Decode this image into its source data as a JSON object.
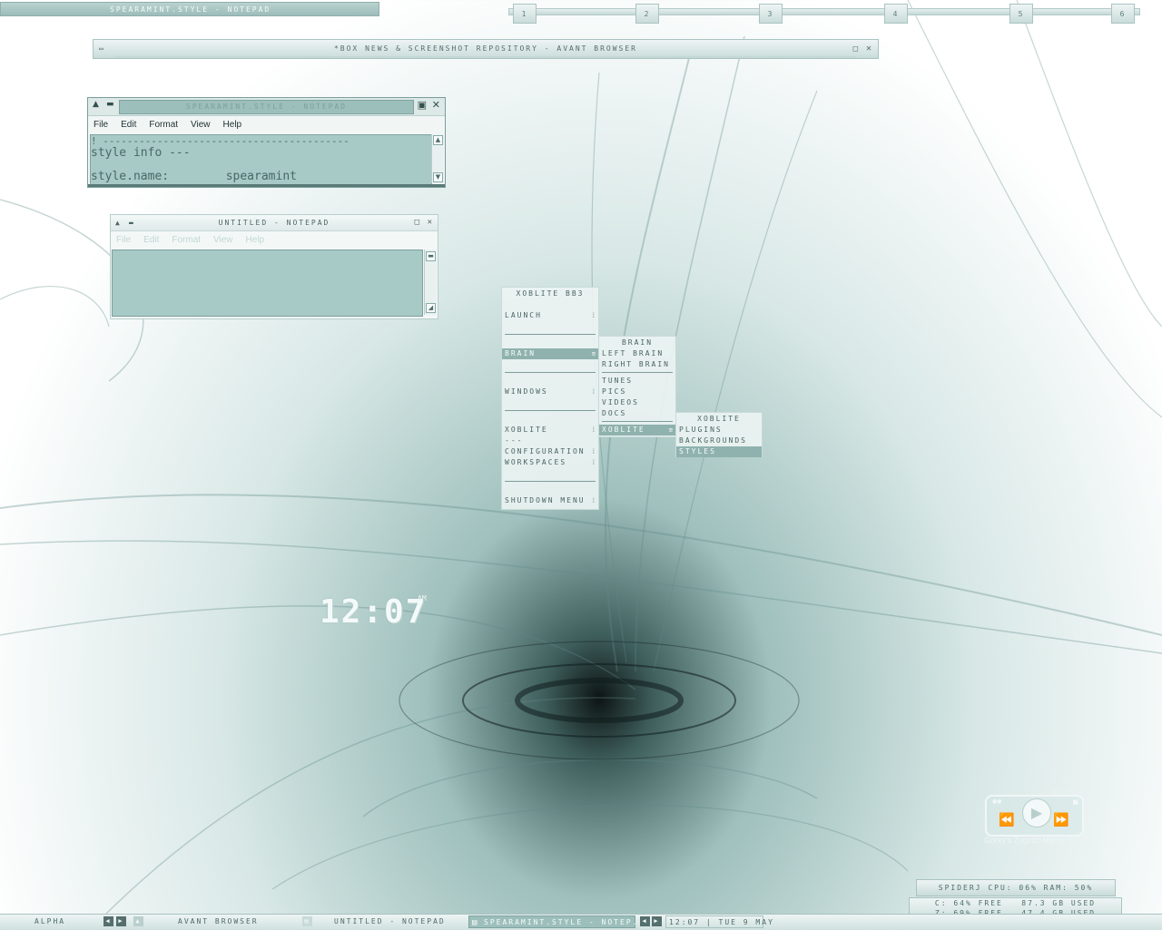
{
  "topbar": {
    "active_window": "SPEARAMINT.STYLE - NOTEPAD",
    "workspaces": [
      "1",
      "2",
      "3",
      "4",
      "5",
      "6"
    ]
  },
  "browser": {
    "title": "*BOX NEWS & SCREENSHOT REPOSITORY - AVANT BROWSER"
  },
  "notepad_style": {
    "title": "SPEARAMINT.STYLE - NOTEPAD",
    "menu": [
      "File",
      "Edit",
      "Format",
      "View",
      "Help"
    ],
    "lines": [
      "! -----------------------------------------",
      "style info ---",
      "",
      "style.name:        spearamint"
    ]
  },
  "notepad_untitled": {
    "title": "UNTITLED - NOTEPAD",
    "menu": [
      "File",
      "Edit",
      "Format",
      "View",
      "Help"
    ]
  },
  "root_menu": {
    "title": "XOBLITE BB3",
    "items": {
      "launch": "LAUNCH",
      "brain": "BRAIN",
      "windows": "WINDOWS",
      "xoblite": "XOBLITE",
      "dashes": "---",
      "configuration": "CONFIGURATION",
      "workspaces": "WORKSPACES",
      "shutdown": "SHUTDOWN MENU"
    }
  },
  "brain_menu": {
    "title": "BRAIN",
    "items": [
      "LEFT BRAIN",
      "RIGHT BRAIN",
      "TUNES",
      "PICS",
      "VIDEOS",
      "DOCS",
      "XOBLITE"
    ]
  },
  "xoblite_menu": {
    "title": "XOBLITE",
    "items": [
      "PLUGINS",
      "BACKGROUNDS",
      "STYLES"
    ]
  },
  "desktop_clock": {
    "time": "12:07",
    "ampm": "AM"
  },
  "player": {
    "time": "02:30",
    "title": "Gorky's Zygotic Mynci"
  },
  "sysmon": {
    "line1": "SPIDERJ CPU: 06% RAM: 50%",
    "drive_c": "C: 64% FREE   87.3 GB USED",
    "drive_z": "Z: 69% FREE   47.4 GB USED"
  },
  "taskbar": {
    "workspace": "ALPHA",
    "tasks": [
      "AVANT BROWSER",
      "UNTITLED - NOTEPAD",
      "SPEARAMINT.STYLE - NOTEP..."
    ],
    "clock": "12:07 | TUE 9 MAY"
  },
  "colors": {
    "accent": "#9dbfbc",
    "text": "#4d6e6c",
    "textarea": "#a8cac7"
  }
}
